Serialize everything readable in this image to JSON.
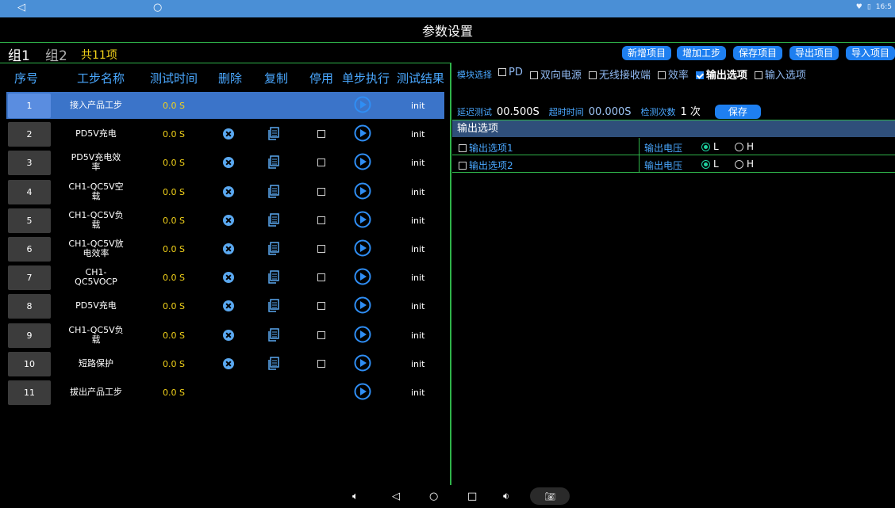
{
  "statusbar": {
    "time": "16:5"
  },
  "title": "参数设置",
  "groups": {
    "tab1": "组1",
    "tab2": "组2",
    "count": "共11项"
  },
  "top_buttons": [
    "新增项目",
    "增加工步",
    "保存项目",
    "导出项目",
    "导入项目"
  ],
  "table": {
    "headers": [
      "序号",
      "工步名称",
      "测试时间",
      "删除",
      "复制",
      "停用",
      "单步执行",
      "测试结果"
    ],
    "rows": [
      {
        "idx": "1",
        "name": "接入产品工步",
        "time": "0.0 S",
        "result": "init",
        "has_actions": false,
        "selected": true
      },
      {
        "idx": "2",
        "name": "PD5V充电",
        "time": "0.0 S",
        "result": "init",
        "has_actions": true,
        "selected": false
      },
      {
        "idx": "3",
        "name": "PD5V充电效\n率",
        "time": "0.0 S",
        "result": "init",
        "has_actions": true,
        "selected": false
      },
      {
        "idx": "4",
        "name": "CH1-QC5V空\n载",
        "time": "0.0 S",
        "result": "init",
        "has_actions": true,
        "selected": false
      },
      {
        "idx": "5",
        "name": "CH1-QC5V负\n载",
        "time": "0.0 S",
        "result": "init",
        "has_actions": true,
        "selected": false
      },
      {
        "idx": "6",
        "name": "CH1-QC5V放\n电效率",
        "time": "0.0 S",
        "result": "init",
        "has_actions": true,
        "selected": false
      },
      {
        "idx": "7",
        "name": "CH1-\nQC5VOCP",
        "time": "0.0 S",
        "result": "init",
        "has_actions": true,
        "selected": false
      },
      {
        "idx": "8",
        "name": "PD5V充电",
        "time": "0.0 S",
        "result": "init",
        "has_actions": true,
        "selected": false
      },
      {
        "idx": "9",
        "name": "CH1-QC5V负\n载",
        "time": "0.0 S",
        "result": "init",
        "has_actions": true,
        "selected": false
      },
      {
        "idx": "10",
        "name": "短路保护",
        "time": "0.0 S",
        "result": "init",
        "has_actions": true,
        "selected": false
      },
      {
        "idx": "11",
        "name": "拔出产品工步",
        "time": "0.0 S",
        "result": "init",
        "has_actions": false,
        "selected": false
      }
    ]
  },
  "module_select": {
    "label": "模块选择",
    "options": [
      {
        "label": "PD",
        "checked": false
      },
      {
        "label": "双向电源",
        "checked": false
      },
      {
        "label": "无线接收端",
        "checked": false
      },
      {
        "label": "效率",
        "checked": false
      },
      {
        "label": "输出选项",
        "checked": true
      },
      {
        "label": "输入选项",
        "checked": false
      }
    ]
  },
  "params": {
    "delay_label": "延迟测试",
    "delay_value": "00.500S",
    "timeout_label": "超时时间",
    "timeout_value": "00.000S",
    "count_label": "检测次数",
    "count_value": "1 次",
    "save_label": "保存"
  },
  "output": {
    "header": "输出选项",
    "rows": [
      {
        "label": "输出选项1",
        "voltage_label": "输出电压",
        "opt_l": "L",
        "opt_h": "H",
        "selected": "L"
      },
      {
        "label": "输出选项2",
        "voltage_label": "输出电压",
        "opt_l": "L",
        "opt_h": "H",
        "selected": "L"
      }
    ]
  },
  "colors": {
    "accent": "#1e7ff0",
    "status_bar": "#4a8fd6",
    "divider": "#2fb34a",
    "time_text": "#f2d21a",
    "header_text": "#4aa8ff"
  }
}
